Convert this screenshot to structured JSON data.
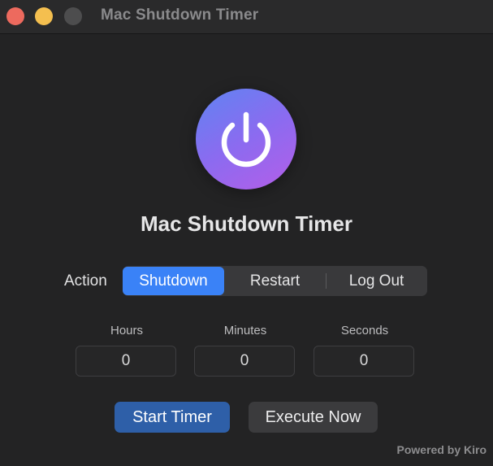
{
  "window": {
    "title": "Mac Shutdown Timer",
    "traffic_lights": {
      "close_color": "#ed6a5e",
      "minimize_color": "#f4bf4f",
      "zoom_color": "#4d4d4e"
    }
  },
  "app": {
    "icon": "power-icon",
    "heading": "Mac Shutdown Timer",
    "gradient_colors": [
      "#5f84f2",
      "#8b6bf0",
      "#b45ee8"
    ]
  },
  "action": {
    "label": "Action",
    "options": [
      "Shutdown",
      "Restart",
      "Log Out"
    ],
    "selected": "Shutdown",
    "accent_color": "#3a82f7"
  },
  "timer": {
    "hours_label": "Hours",
    "hours_value": "0",
    "minutes_label": "Minutes",
    "minutes_value": "0",
    "seconds_label": "Seconds",
    "seconds_value": "0"
  },
  "buttons": {
    "start_label": "Start Timer",
    "execute_label": "Execute Now"
  },
  "footer": {
    "text": "Powered by Kiro"
  }
}
